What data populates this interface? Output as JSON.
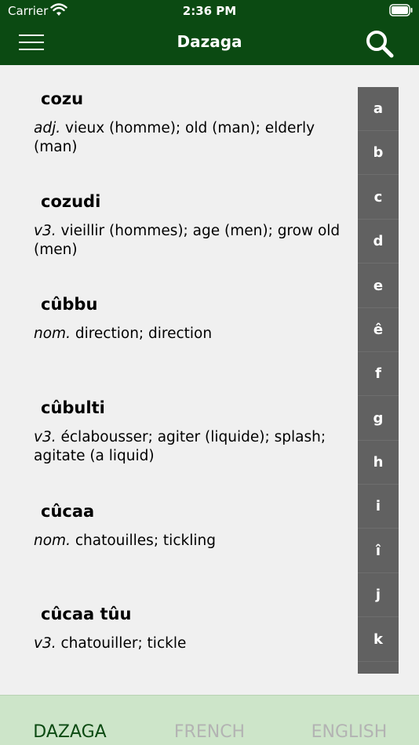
{
  "status": {
    "carrier": "Carrier",
    "time": "2:36 PM"
  },
  "header": {
    "title": "Dazaga"
  },
  "entries": [
    {
      "word": "cozu",
      "pos": "adj.",
      "def": "vieux (homme); old (man); elderly (man)"
    },
    {
      "word": "cozudi",
      "pos": "v3.",
      "def": "vieillir (hommes); age (men); grow old (men)"
    },
    {
      "word": "cûbbu",
      "pos": "nom.",
      "def": "direction; direction"
    },
    {
      "word": "cûbulti",
      "pos": "v3.",
      "def": "éclabousser; agiter (liquide); splash; agitate (a liquid)"
    },
    {
      "word": "cûcaa",
      "pos": "nom.",
      "def": "chatouilles; tickling"
    },
    {
      "word": "cûcaa tûu",
      "pos": "v3.",
      "def": "chatouiller; tickle"
    }
  ],
  "index": [
    "a",
    "b",
    "c",
    "d",
    "e",
    "ê",
    "f",
    "g",
    "h",
    "i",
    "î",
    "j",
    "k"
  ],
  "tabs": {
    "dazaga": "DAZAGA",
    "french": "FRENCH",
    "english": "ENGLISH"
  },
  "colors": {
    "header": "#0b4a12",
    "tabbar": "#cde5c9",
    "index": "#616161"
  }
}
